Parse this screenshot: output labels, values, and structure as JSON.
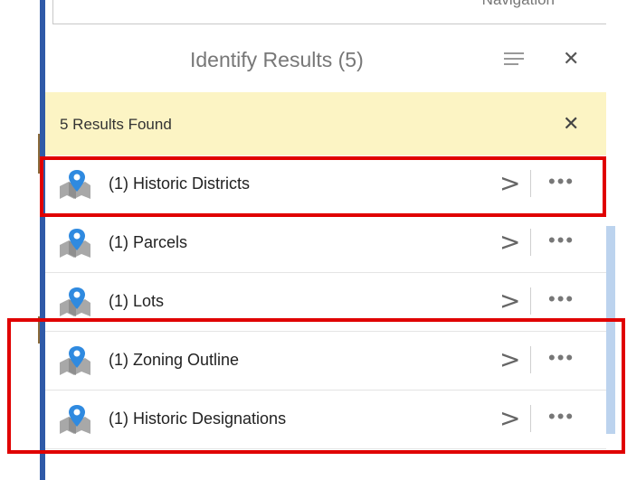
{
  "navigation": {
    "label": "Navigation"
  },
  "header": {
    "title": "Identify Results (5)"
  },
  "banner": {
    "text": "5 Results Found"
  },
  "results": [
    {
      "label": "(1) Historic Districts"
    },
    {
      "label": "(1) Parcels"
    },
    {
      "label": "(1) Lots"
    },
    {
      "label": "(1) Zoning Outline"
    },
    {
      "label": "(1) Historic Designations"
    }
  ],
  "icons": {
    "layer": "map-pin-layer-icon",
    "chevron": "chevron-right-icon",
    "more": "more-horizontal-icon",
    "close": "close-icon",
    "menu": "list-menu-icon"
  },
  "colors": {
    "highlight": "#e00000",
    "banner_bg": "#fcf4c4",
    "pin": "#2f8ae0",
    "title": "#777777"
  }
}
